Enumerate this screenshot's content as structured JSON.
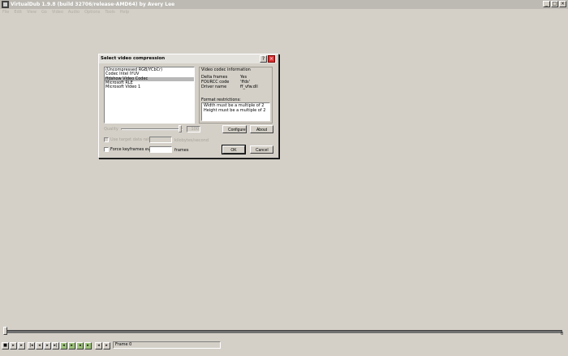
{
  "app": {
    "title": "VirtualDub 1.9.8 (build 32706/release-AMD64) by Avery Lee",
    "window_buttons": [
      "_",
      "□",
      "×"
    ]
  },
  "menu": [
    "File",
    "Edit",
    "View",
    "Go",
    "Video",
    "Audio",
    "Options",
    "Tools",
    "Help"
  ],
  "dialog": {
    "title": "Select video compression",
    "help_label": "?",
    "close_label": "×",
    "codecs": [
      {
        "label": "(Uncompressed RGB/YCbCr)",
        "selected": false
      },
      {
        "label": "Codec Intel IYUV",
        "selected": false
      },
      {
        "label": "ffdshow Video Codec",
        "selected": true
      },
      {
        "label": "Microsoft RLE",
        "selected": false
      },
      {
        "label": "Microsoft Video 1",
        "selected": false
      }
    ],
    "info": {
      "group_label": "Video codec information",
      "rows": [
        {
          "key": "Delta frames",
          "value": "Yes"
        },
        {
          "key": "FOURCC code",
          "value": "'ffds'"
        },
        {
          "key": "Driver name",
          "value": "ff_vfw.dll"
        }
      ],
      "restrictions_label": "Format restrictions:",
      "restrictions": [
        "Width must be a multiple of 2",
        "Height must be a multiple of 2"
      ]
    },
    "quality": {
      "label": "Quality",
      "value": "100"
    },
    "data_rate": {
      "label": "Use target data rate of",
      "unit": "kilobytes/second",
      "checked": false
    },
    "keyframes": {
      "label": "Force keyframes every",
      "unit": "frames",
      "checked": false
    },
    "buttons": {
      "configure": "Configure",
      "about": "About",
      "ok": "OK",
      "cancel": "Cancel"
    }
  },
  "timeline": {
    "end_label": "0"
  },
  "status": {
    "frame_text": "Frame 0"
  },
  "colors": {
    "selection": "#b8b8b8",
    "background": "#d4d0c8",
    "close": "#dd3333"
  }
}
